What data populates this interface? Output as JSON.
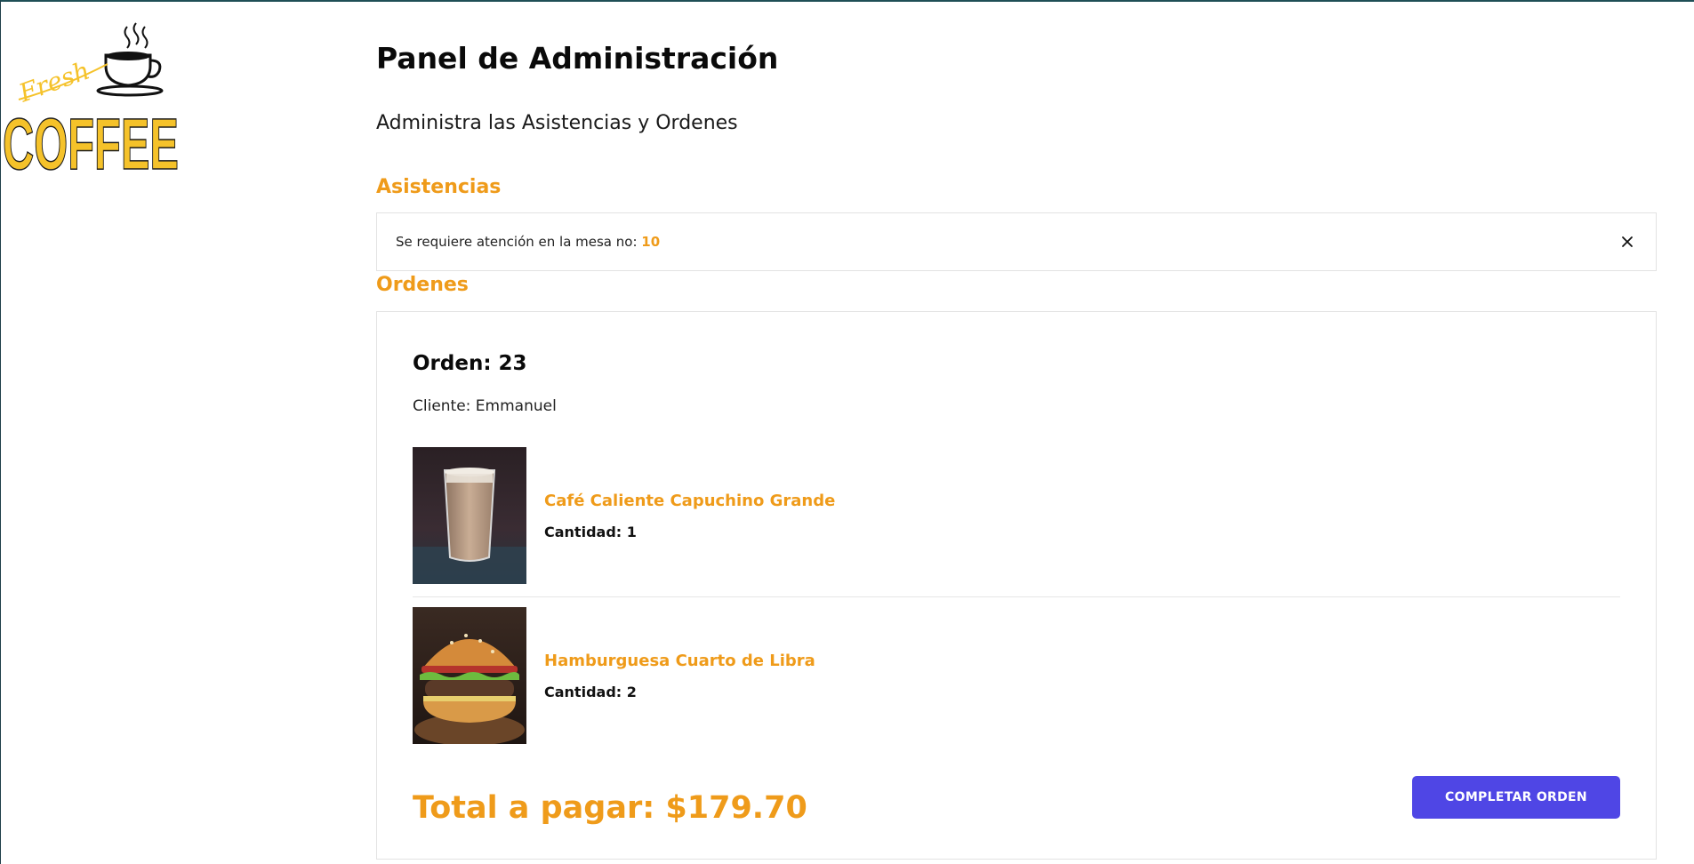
{
  "brand": {
    "logo_script": "Fresh",
    "logo_word": "COFFEE",
    "accent_color": "#ef9b1a",
    "logo_color": "#f5c22a",
    "button_color": "#4f46e5",
    "icons": [
      "coffee-cup-icon",
      "close-icon"
    ]
  },
  "header": {
    "title": "Panel de Administración",
    "subtitle": "Administra las Asistencias y Ordenes"
  },
  "assistance": {
    "section_title": "Asistencias",
    "alert_text": "Se requiere atención en la mesa no:",
    "table_number": "10"
  },
  "orders": {
    "section_title": "Ordenes",
    "order": {
      "label": "Orden: 23",
      "client": "Cliente: Emmanuel",
      "items": [
        {
          "name": "Café Caliente Capuchino Grande",
          "quantity": "Cantidad: 1",
          "image": "cappuccino-photo"
        },
        {
          "name": "Hamburguesa Cuarto de Libra",
          "quantity": "Cantidad: 2",
          "image": "burger-photo"
        }
      ],
      "total": "Total a pagar: $179.70",
      "complete_label": "COMPLETAR ORDEN"
    }
  }
}
